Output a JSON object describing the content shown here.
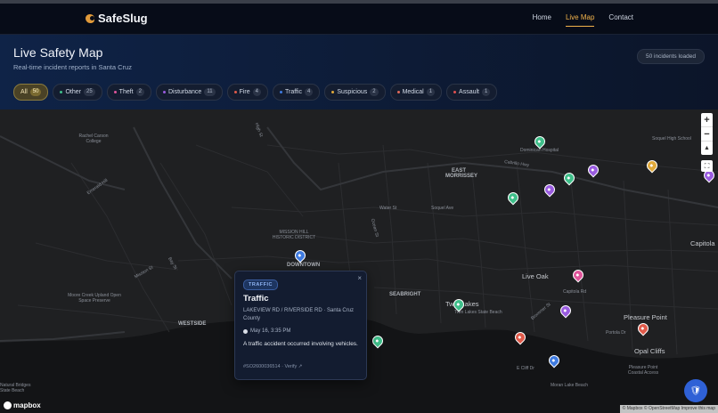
{
  "app": {
    "name": "SafeSlug"
  },
  "nav": {
    "home": "Home",
    "live_map": "Live Map",
    "contact": "Contact"
  },
  "hero": {
    "title": "Live Safety Map",
    "subtitle": "Real-time incident reports in Santa Cruz",
    "loaded": "50 incidents loaded"
  },
  "filters": [
    {
      "label": "All",
      "count": "50",
      "color": "#f2b34b"
    },
    {
      "label": "Other",
      "count": "25",
      "color": "#3fbf8a"
    },
    {
      "label": "Theft",
      "count": "2",
      "color": "#e0549a"
    },
    {
      "label": "Disturbance",
      "count": "11",
      "color": "#9a5ce0"
    },
    {
      "label": "Fire",
      "count": "4",
      "color": "#e05a4a"
    },
    {
      "label": "Traffic",
      "count": "4",
      "color": "#3f7be0"
    },
    {
      "label": "Suspicious",
      "count": "2",
      "color": "#e0a93a"
    },
    {
      "label": "Medical",
      "count": "1",
      "color": "#e06a5a"
    },
    {
      "label": "Assault",
      "count": "1",
      "color": "#e05050"
    }
  ],
  "map": {
    "labels": {
      "rachel_carson": "Rachel Carson College",
      "emerald": "Emerald Hill",
      "moore_creek": "Moore Creek Upland Open Space Preserve",
      "mission_hill": "MISSION HILL HISTORIC DISTRICT",
      "downtown": "DOWNTOWN",
      "westside": "WESTSIDE",
      "seabright": "SEABRIGHT",
      "live_oak": "Live Oak",
      "twin_lakes": "Twin Lakes",
      "pleasure_point": "Pleasure Point",
      "opal_cliffs": "Opal Cliffs",
      "capitola": "Capitola",
      "east_morrissey": "EAST MORRISSEY",
      "natural_bridges": "Natural Bridges State Beach",
      "twin_lakes_beach": "Twin Lakes State Beach",
      "moran_lake": "Moran Lake Beach",
      "pleasure_point_park": "Pleasure Point Coastal Access",
      "dominican": "Dominican Hospital",
      "soquel_hs": "Soquel High School",
      "ocean_st": "Ocean St",
      "water_st": "Water St",
      "soquel_ave": "Soquel Ave",
      "cabrillo_hwy": "Cabrillo Hwy",
      "capitola_rd": "Capitola Rd",
      "brommer_st": "Brommer St",
      "portola_dr": "Portola Dr",
      "east_cliff_dr": "E Cliff Dr",
      "mission_st": "Mission St",
      "bay_st": "Bay St",
      "high_st": "High St"
    },
    "popup": {
      "badge": "TRAFFIC",
      "title": "Traffic",
      "address": "LAKEVIEW RD / RIVERSIDE RD · Santa Cruz County",
      "time": "May 16, 3:35 PM",
      "description": "A traffic accident occurred involving vehicles.",
      "footer": "#SO2600036514 · Verify ↗",
      "close": "×"
    },
    "controls": {
      "zoom_in": "+",
      "zoom_out": "−",
      "compass": "▲",
      "fullscreen": "⛶"
    },
    "mapbox": "mapbox",
    "attribution": "© Mapbox © OpenStreetMap  Improve this map"
  },
  "pins": [
    {
      "category": "Other",
      "color": "#3fbf8a"
    },
    {
      "category": "Disturbance",
      "color": "#9a5ce0"
    },
    {
      "category": "Suspicious",
      "color": "#e0a93a"
    },
    {
      "category": "Disturbance",
      "color": "#9a5ce0"
    },
    {
      "category": "Other",
      "color": "#3fbf8a"
    },
    {
      "category": "Other",
      "color": "#3fbf8a"
    },
    {
      "category": "Disturbance",
      "color": "#9a5ce0"
    },
    {
      "category": "Traffic",
      "color": "#3f7be0"
    },
    {
      "category": "Theft",
      "color": "#e0549a"
    },
    {
      "category": "Other",
      "color": "#3fbf8a"
    },
    {
      "category": "Disturbance",
      "color": "#9a5ce0"
    },
    {
      "category": "Fire",
      "color": "#e05a4a"
    },
    {
      "category": "Fire",
      "color": "#e05a4a"
    },
    {
      "category": "Other",
      "color": "#3fbf8a"
    },
    {
      "category": "Traffic",
      "color": "#3f7be0"
    }
  ]
}
